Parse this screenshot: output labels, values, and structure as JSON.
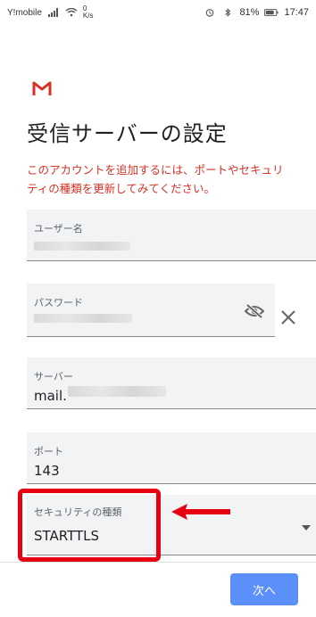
{
  "status_bar": {
    "carrier": "Y!mobile",
    "netspeed_value": "0",
    "netspeed_unit": "K/s",
    "battery": "81%",
    "time": "17:47",
    "icons": [
      "signal-icon",
      "wifi-icon",
      "alarm-icon",
      "bluetooth-icon",
      "battery-icon"
    ]
  },
  "brand": {
    "logo": "gmail-logo",
    "accent": "#d93025",
    "button_color": "#5b8ff9"
  },
  "page": {
    "title": "受信サーバーの設定",
    "error": "このアカウントを追加するには、ポートやセキュリティの種類を更新してみてください。"
  },
  "fields": {
    "username": {
      "label": "ユーザー名",
      "value": ""
    },
    "password": {
      "label": "パスワード",
      "value": ""
    },
    "server": {
      "label": "サーバー",
      "value": "mail."
    },
    "port": {
      "label": "ポート",
      "value": "143"
    },
    "security": {
      "label": "セキュリティの種類",
      "value": "STARTTLS"
    }
  },
  "actions": {
    "next_label": "次へ"
  },
  "annotation": {
    "highlight_color": "#e60012"
  }
}
